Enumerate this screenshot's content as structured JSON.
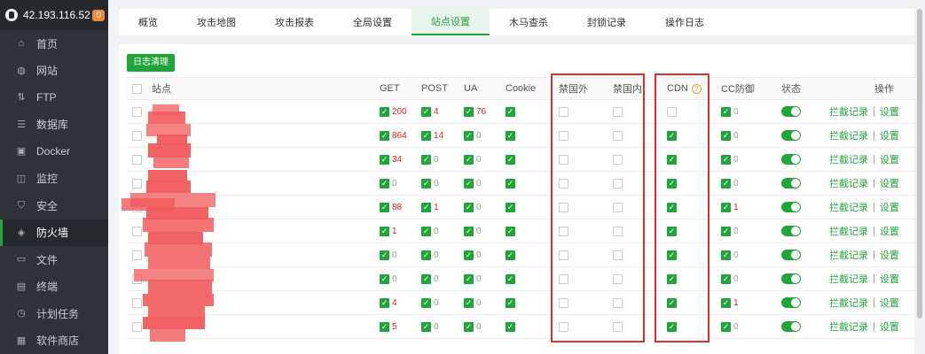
{
  "sidebar": {
    "host": "42.193.116.52",
    "badge": "0",
    "items": [
      {
        "label": "首页",
        "icon": "home-icon",
        "glyph": "⌂"
      },
      {
        "label": "网站",
        "icon": "globe-icon",
        "glyph": "◍"
      },
      {
        "label": "FTP",
        "icon": "ftp-icon",
        "glyph": "⇅"
      },
      {
        "label": "数据库",
        "icon": "database-icon",
        "glyph": "☰",
        "active": true
      },
      {
        "label": "Docker",
        "icon": "docker-icon",
        "glyph": "▣"
      },
      {
        "label": "监控",
        "icon": "monitor-icon",
        "glyph": "◫"
      },
      {
        "label": "安全",
        "icon": "shield-icon",
        "glyph": "⛉"
      },
      {
        "label": "防火墙",
        "icon": "firewall-icon",
        "glyph": "◈",
        "highlight": true
      },
      {
        "label": "文件",
        "icon": "folder-icon",
        "glyph": "▭"
      },
      {
        "label": "终端",
        "icon": "terminal-icon",
        "glyph": "▤"
      },
      {
        "label": "计划任务",
        "icon": "clock-icon",
        "glyph": "◷"
      },
      {
        "label": "软件商店",
        "icon": "store-icon",
        "glyph": "▦"
      }
    ]
  },
  "tabs": [
    "概览",
    "攻击地图",
    "攻击报表",
    "全局设置",
    "站点设置",
    "木马查杀",
    "封锁记录",
    "操作日志"
  ],
  "active_tab": 4,
  "clear_log_button": "日志清理",
  "table": {
    "headers": {
      "site": "站点",
      "get": "GET",
      "post": "POST",
      "ua": "UA",
      "cookie": "Cookie",
      "block_foreign": "禁国外",
      "block_domestic": "禁国内",
      "cdn": "CDN",
      "cc": "CC防御",
      "status": "状态",
      "actions": "操作"
    },
    "action_intercept": "拦截记录",
    "action_sep": "|",
    "action_settings": "设置",
    "rows": [
      {
        "get": "200",
        "post": "4",
        "ua": "76",
        "cdn": false,
        "cc": "0"
      },
      {
        "get": "864",
        "post": "14",
        "ua": "0",
        "cdn": true,
        "cc": "0"
      },
      {
        "get": "34",
        "post": "0",
        "ua": "0",
        "cdn": true,
        "cc": "0"
      },
      {
        "get": "0",
        "post": "0",
        "ua": "0",
        "cdn": true,
        "cc": "0"
      },
      {
        "get": "88",
        "post": "1",
        "ua": "0",
        "cdn": true,
        "cc": "1"
      },
      {
        "get": "1",
        "post": "0",
        "ua": "0",
        "cdn": true,
        "cc": "0"
      },
      {
        "get": "0",
        "post": "0",
        "ua": "0",
        "cdn": true,
        "cc": "0"
      },
      {
        "get": "0",
        "post": "0",
        "ua": "0",
        "cdn": true,
        "cc": "0"
      },
      {
        "get": "4",
        "post": "0",
        "ua": "0",
        "cdn": true,
        "cc": "1"
      },
      {
        "get": "5",
        "post": "0",
        "ua": "0",
        "cdn": true,
        "cc": "0"
      }
    ]
  },
  "colors": {
    "accent": "#20a53a",
    "alert": "#e02020",
    "outline": "#d9302f"
  }
}
